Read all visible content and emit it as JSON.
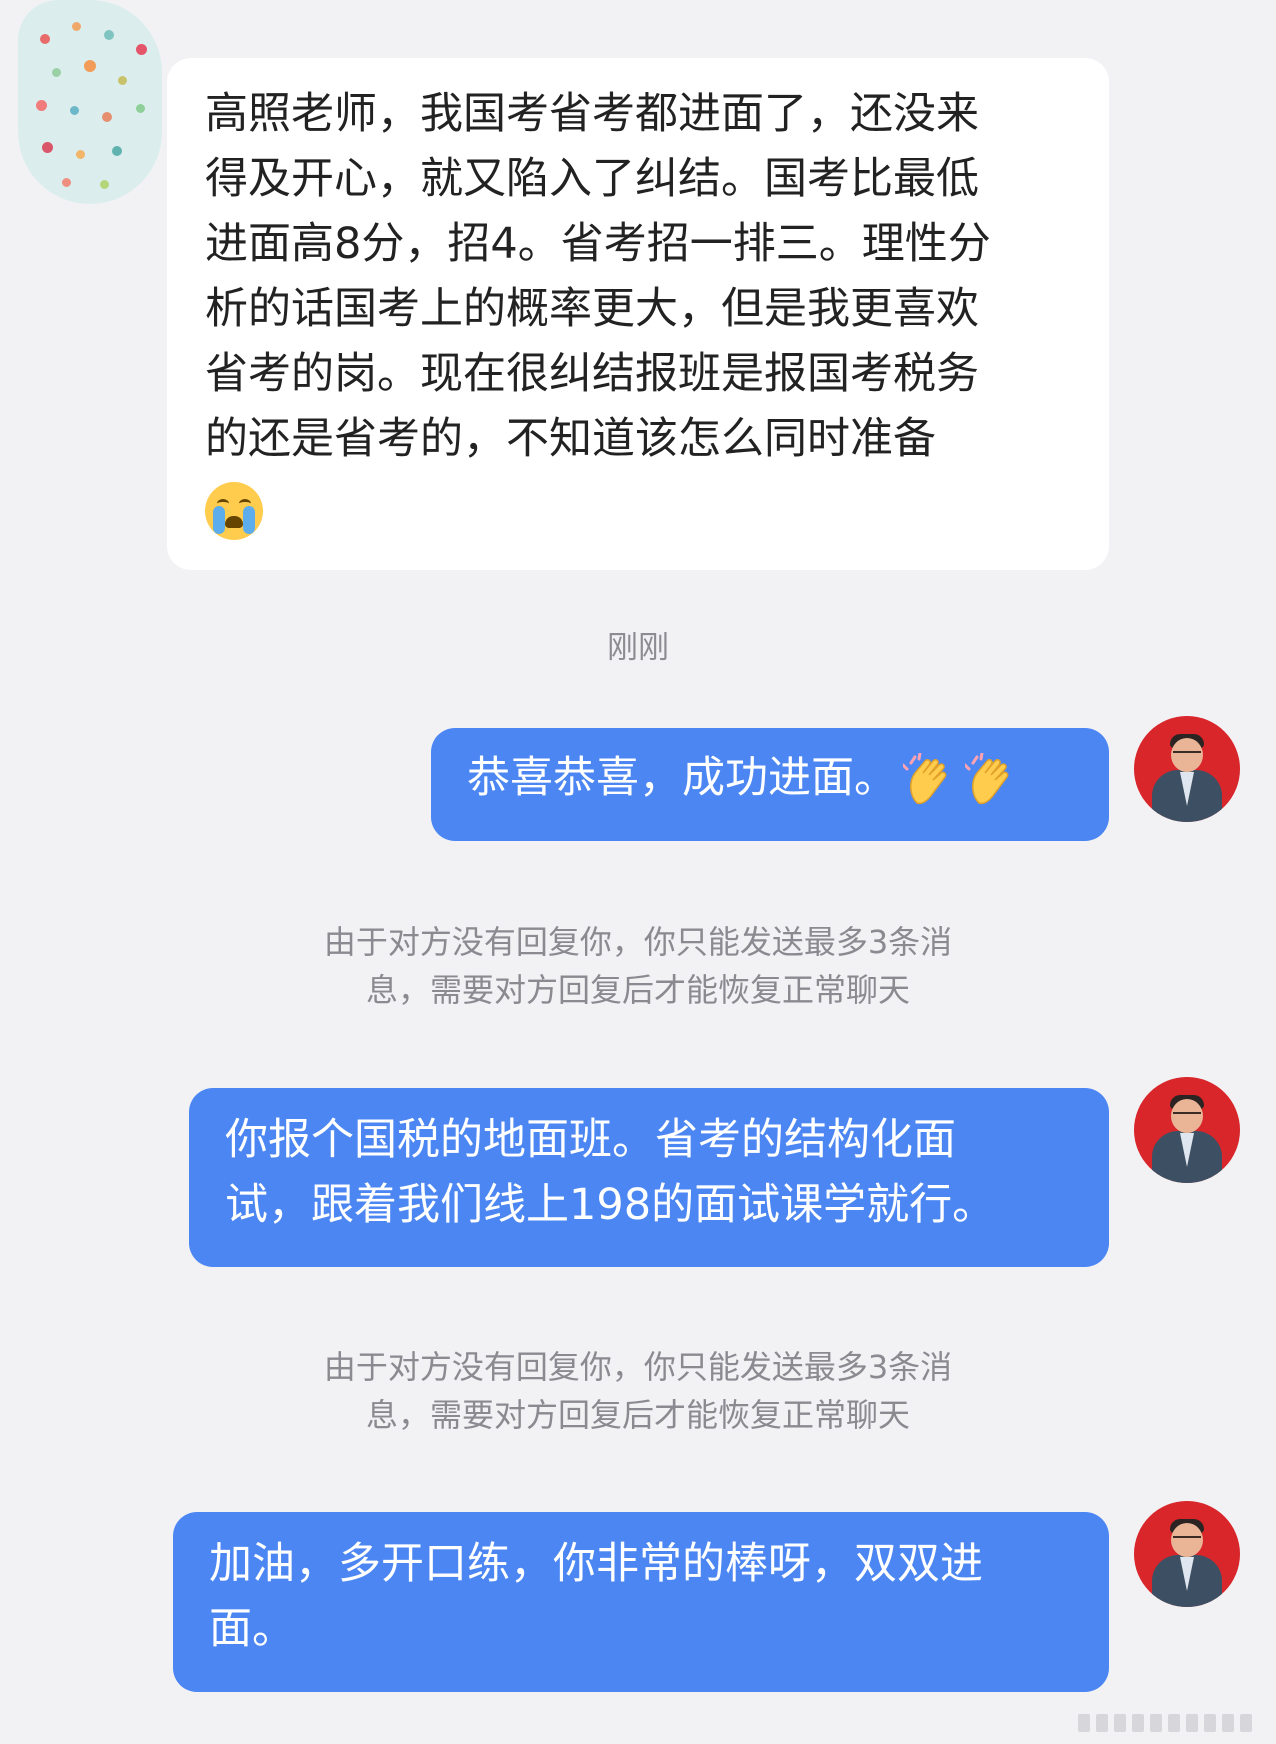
{
  "chat": {
    "incoming_message": "高照老师，我国考省考都进面了，还没来\n得及开心，就又陷入了纠结。国考比最低\n进面高8分，招4。省考招一排三。理性分\n析的话国考上的概率更大，但是我更喜欢\n省考的岗。现在很纠结报班是报国考税务\n的还是省考的，不知道该怎么同时准备",
    "incoming_emoji": "loudly-crying-face",
    "timestamp": "刚刚",
    "messages": [
      {
        "text": "恭喜恭喜，成功进面。",
        "emoji": "clapping-hands x2"
      },
      {
        "text": "你报个国税的地面班。省考的结构化面\n试，跟着我们线上198的面试课学就行。"
      },
      {
        "text": "加油，多开口练，你非常的棒呀，双双进\n面。"
      }
    ],
    "system_notes": [
      "由于对方没有回复你，你只能发送最多3条消\n息，需要对方回复后才能恢复正常聊天",
      "由于对方没有回复你，你只能发送最多3条消\n息，需要对方回复后才能恢复正常聊天"
    ],
    "colors": {
      "background": "#f2f2f5",
      "outgoing_bubble": "#4b86f3",
      "incoming_bubble": "#ffffff",
      "avatar_background": "#d8262b"
    }
  }
}
